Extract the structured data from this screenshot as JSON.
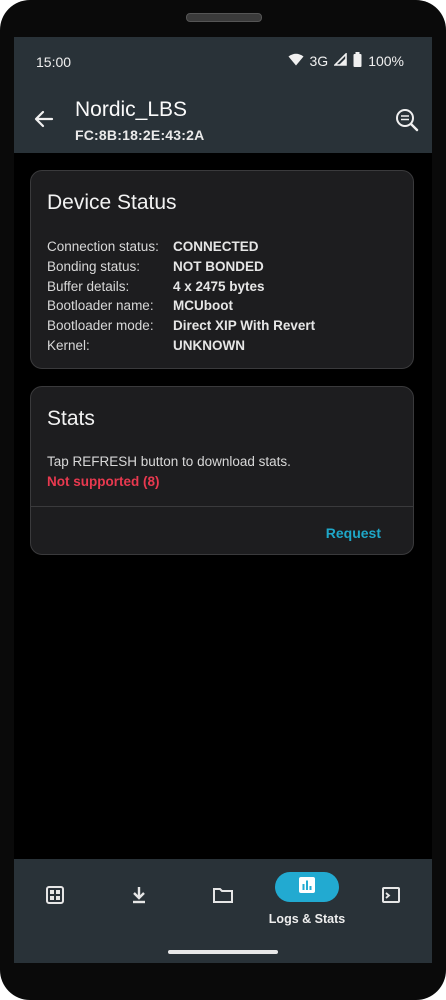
{
  "status_bar": {
    "time": "15:00",
    "network": "3G",
    "battery": "100%"
  },
  "app_bar": {
    "title": "Nordic_LBS",
    "subtitle": "FC:8B:18:2E:43:2A"
  },
  "device_status": {
    "title": "Device Status",
    "rows": [
      {
        "label": "Connection status:",
        "value": "CONNECTED"
      },
      {
        "label": "Bonding status:",
        "value": "NOT BONDED"
      },
      {
        "label": "Buffer details:",
        "value": "4 x 2475 bytes"
      },
      {
        "label": "Bootloader name:",
        "value": "MCUboot"
      },
      {
        "label": "Bootloader mode:",
        "value": "Direct XIP With Revert"
      },
      {
        "label": "Kernel:",
        "value": "UNKNOWN"
      }
    ]
  },
  "stats": {
    "title": "Stats",
    "description": "Tap REFRESH button to download stats.",
    "error": "Not supported (8)",
    "action_label": "Request"
  },
  "bottom_nav": {
    "items": [
      {
        "icon": "dashboard-icon",
        "label": ""
      },
      {
        "icon": "download-icon",
        "label": ""
      },
      {
        "icon": "folder-icon",
        "label": ""
      },
      {
        "icon": "bar-chart-icon",
        "label": "Logs & Stats",
        "active": true
      },
      {
        "icon": "terminal-icon",
        "label": ""
      }
    ]
  },
  "colors": {
    "bar_bg": "#293238",
    "accent": "#22aad1",
    "error": "#e8394f",
    "link": "#1ea7c8"
  }
}
